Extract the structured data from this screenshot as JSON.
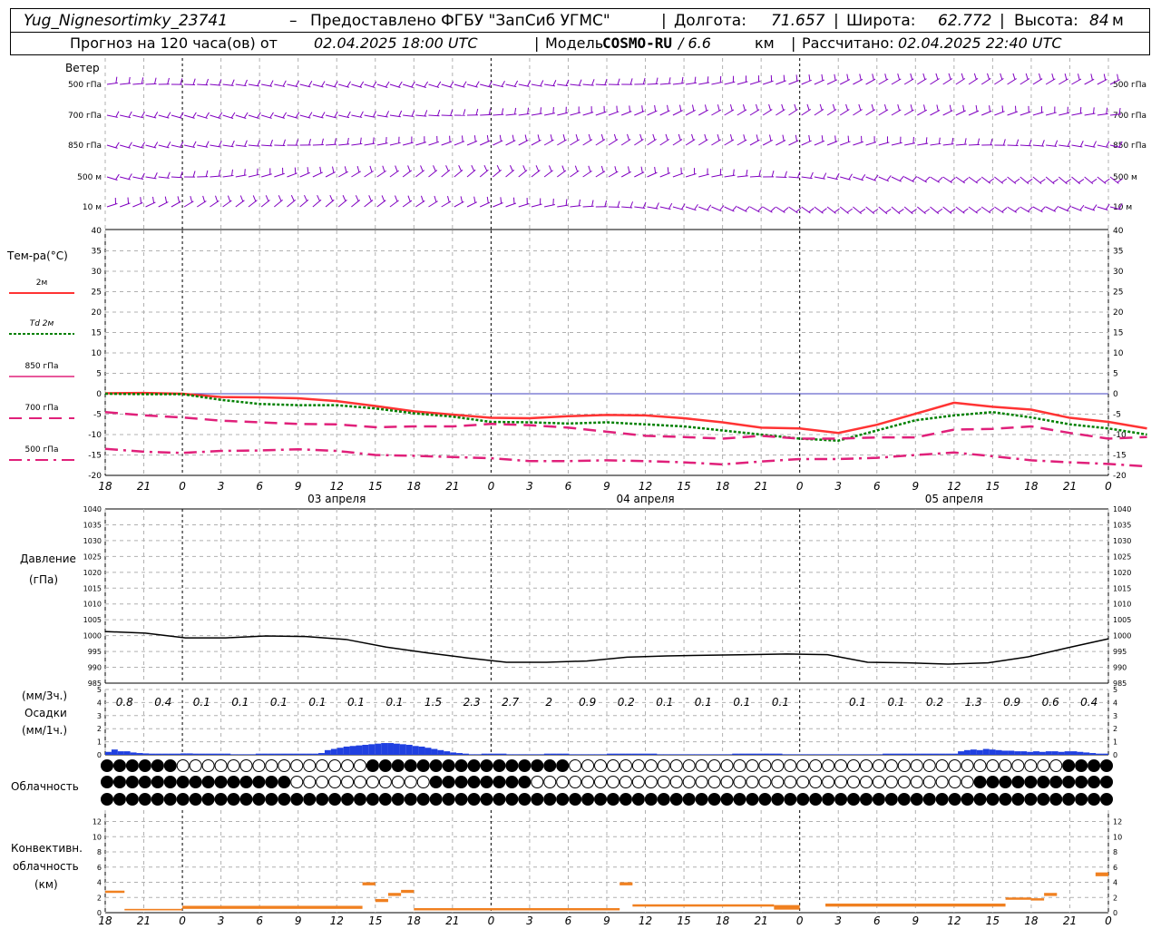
{
  "header": {
    "station": "Yug_Nignesortimky_23741",
    "dash": "–",
    "provided": "Предоставлено ФГБУ \"ЗапСиб УГМС\"",
    "lon_label": "Долгота:",
    "lon": "71.657",
    "lat_label": "Широта:",
    "lat": "62.772",
    "alt_label": "Высота:",
    "alt": "84",
    "alt_unit": "м",
    "forecast_label": "Прогноз на 120 часа(ов) от",
    "forecast_from": "02.04.2025 18:00 UTC",
    "model_label": "Модель",
    "model": "COSMO-RU",
    "resolution": "/ 6.6",
    "resolution_unit": "км",
    "calc_label": "Рассчитано:",
    "calc": "02.04.2025 22:40 UTC"
  },
  "wind_panel": {
    "title": "Ветер",
    "levels": [
      "500 гПа",
      "700 гПа",
      "850 гПа",
      "500 м",
      "10 м"
    ],
    "color": "#8000c0"
  },
  "temp_panel": {
    "title": "Тем-ра(°С)",
    "legend": [
      {
        "label": "2м",
        "color": "#ff3333",
        "style": "solid"
      },
      {
        "label": "Td  2м",
        "color": "#008000",
        "style": "dotted"
      },
      {
        "label": "850 гПа",
        "color": "#e0207a",
        "style": "solid-thin"
      },
      {
        "label": "700 гПа",
        "color": "#e0207a",
        "style": "dash"
      },
      {
        "label": "500 гПа",
        "color": "#e0207a",
        "style": "dashdot"
      }
    ]
  },
  "pressure_panel": {
    "title1": "Давление",
    "title2": "(гПа)"
  },
  "precip_panel": {
    "title1": "(мм/3ч.)",
    "title2": "Осадки",
    "title3": "(мм/1ч.)",
    "labels": [
      "0.8",
      "0.4",
      "0.1",
      "0.1",
      "0.1",
      "0.1",
      "0.1",
      "0.1",
      "1.5",
      "2.3",
      "2.7",
      "2",
      "0.9",
      "0.2",
      "0.1",
      "0.1",
      "0.1",
      "0.1",
      "",
      "0.1",
      "0.1",
      "0.2",
      "1.3",
      "0.9",
      "0.6",
      "0.4"
    ]
  },
  "cloud_panel": {
    "title": "Облачность"
  },
  "conv_panel": {
    "title1": "Конвективн.",
    "title2": "облачность",
    "title3": "(км)"
  },
  "date_labels": [
    "03 апреля",
    "04 апреля",
    "05 апреля"
  ],
  "hour_labels": [
    "18",
    "21",
    "0",
    "3",
    "6",
    "9",
    "12",
    "15",
    "18",
    "21",
    "0",
    "3",
    "6",
    "9",
    "12",
    "15",
    "18",
    "21",
    "0",
    "3",
    "6",
    "9",
    "12",
    "15",
    "18",
    "21",
    "0"
  ],
  "chart_data": [
    {
      "type": "line",
      "title": "Тем-ра(°С)",
      "x": [
        0,
        3,
        6,
        9,
        12,
        15,
        18,
        21,
        24,
        27,
        30,
        33,
        36,
        39,
        42,
        45,
        48,
        51,
        54,
        57,
        60,
        63,
        66,
        69,
        72,
        75,
        78
      ],
      "ylim": [
        -20,
        40
      ],
      "yticks": [
        -20,
        -15,
        -10,
        -5,
        0,
        5,
        10,
        15,
        20,
        25,
        30,
        35,
        40
      ],
      "series": [
        {
          "name": "2м",
          "values": [
            0.1,
            0.2,
            0.0,
            -0.8,
            -0.9,
            -1.1,
            -1.8,
            -3.0,
            -4.3,
            -5.1,
            -5.9,
            -6.0,
            -5.5,
            -5.2,
            -5.3,
            -6.0,
            -7.0,
            -8.3,
            -8.5,
            -9.6,
            -7.6,
            -4.9,
            -2.2,
            -3.2,
            -3.9,
            -5.9,
            -6.9,
            -8.5
          ]
        },
        {
          "name": "Td 2м",
          "values": [
            0.0,
            -0.1,
            -0.1,
            -1.5,
            -2.5,
            -2.8,
            -2.8,
            -3.6,
            -4.8,
            -5.6,
            -6.9,
            -7.0,
            -7.3,
            -7.0,
            -7.5,
            -8.0,
            -9.0,
            -10.0,
            -11.0,
            -11.5,
            -9.0,
            -6.5,
            -5.3,
            -4.5,
            -5.8,
            -7.5,
            -8.5,
            -10.0
          ]
        },
        {
          "name": "850 гПа",
          "values": []
        },
        {
          "name": "700 гПа",
          "values": [
            -4.5,
            -5.3,
            -5.8,
            -6.6,
            -7.0,
            -7.4,
            -7.5,
            -8.2,
            -8.0,
            -8.0,
            -7.4,
            -7.7,
            -8.3,
            -9.3,
            -10.3,
            -10.6,
            -11.0,
            -10.3,
            -11.0,
            -11.0,
            -10.7,
            -10.7,
            -8.8,
            -8.6,
            -8.0,
            -9.6,
            -11.0,
            -10.6
          ]
        },
        {
          "name": "500 гПа",
          "values": [
            -13.5,
            -14.2,
            -14.5,
            -14.0,
            -13.9,
            -13.6,
            -14.0,
            -15.0,
            -15.2,
            -15.5,
            -15.8,
            -16.5,
            -16.5,
            -16.3,
            -16.5,
            -16.8,
            -17.3,
            -16.6,
            -16.0,
            -16.0,
            -15.7,
            -15.0,
            -14.4,
            -15.3,
            -16.3,
            -16.8,
            -17.2,
            -17.8
          ]
        }
      ],
      "colors": [
        "#ff3333",
        "#008000",
        "#e0207a",
        "#e0207a",
        "#e0207a"
      ]
    },
    {
      "type": "line",
      "title": "Давление (гПа)",
      "x": [
        0,
        3,
        6,
        9,
        12,
        15,
        18,
        21,
        24,
        27,
        30,
        33,
        36,
        39,
        42,
        45,
        48,
        51,
        54,
        57,
        60,
        63,
        66,
        69,
        72,
        75,
        78
      ],
      "ylim": [
        985,
        1040
      ],
      "yticks": [
        985,
        990,
        995,
        1000,
        1005,
        1010,
        1015,
        1020,
        1025,
        1030,
        1035,
        1040
      ],
      "series": [
        {
          "name": "",
          "values": [
            1001.3,
            1000.8,
            999.3,
            999.3,
            999.9,
            999.7,
            998.8,
            996.4,
            994.6,
            993.0,
            991.6,
            991.6,
            992.0,
            993.2,
            993.6,
            993.8,
            994.0,
            994.2,
            994.0,
            991.6,
            991.4,
            991.0,
            991.4,
            993.3,
            996.2,
            999.0
          ]
        }
      ]
    },
    {
      "type": "bar",
      "title": "Осадки (мм/1ч.)",
      "ylim": [
        0,
        5
      ],
      "x_hours": "every 1h from 18 UTC",
      "series": [
        {
          "name": "",
          "values": [
            0.25,
            0.45,
            0.3,
            0.3,
            0.2,
            0.15,
            0.12,
            0.1,
            0.1,
            0.1,
            0.1,
            0.1,
            0.12,
            0.12,
            0.1,
            0.1,
            0.1,
            0.1,
            0.1,
            0.1,
            0.05,
            0.05,
            0.05,
            0.05,
            0.1,
            0.1,
            0.1,
            0.1,
            0.1,
            0.1,
            0.1,
            0.1,
            0.1,
            0.1,
            0.15,
            0.4,
            0.5,
            0.6,
            0.7,
            0.75,
            0.8,
            0.85,
            0.9,
            0.95,
            1.0,
            1.0,
            0.95,
            0.9,
            0.85,
            0.75,
            0.7,
            0.6,
            0.5,
            0.4,
            0.3,
            0.2,
            0.15,
            0.1,
            0.05,
            0.05,
            0.1,
            0.1,
            0.1,
            0.1,
            0.05,
            0.05,
            0.05,
            0.05,
            0.05,
            0.05,
            0.1,
            0.1,
            0.1,
            0.1,
            0.05,
            0.05,
            0.05,
            0.05,
            0.05,
            0.05,
            0.1,
            0.1,
            0.1,
            0.1,
            0.1,
            0.1,
            0.1,
            0.1,
            0.05,
            0.05,
            0.05,
            0.05,
            0.05,
            0.05,
            0.05,
            0.05,
            0.05,
            0.05,
            0.05,
            0.05,
            0.1,
            0.1,
            0.1,
            0.1,
            0.1,
            0.1,
            0.1,
            0.1,
            0.05,
            0.05,
            0.05,
            0.05,
            0.05,
            0.05,
            0.05,
            0.05,
            0.05,
            0.05,
            0.05,
            0.05,
            0.05,
            0.05,
            0.05,
            0.05,
            0.1,
            0.1,
            0.1,
            0.1,
            0.1,
            0.1,
            0.1,
            0.1,
            0.1,
            0.1,
            0.1,
            0.1,
            0.3,
            0.4,
            0.45,
            0.4,
            0.5,
            0.45,
            0.4,
            0.35,
            0.35,
            0.3,
            0.3,
            0.25,
            0.3,
            0.25,
            0.3,
            0.3,
            0.25,
            0.3,
            0.3,
            0.25,
            0.2,
            0.15,
            0.1,
            0.1
          ]
        }
      ]
    },
    {
      "type": "bar",
      "title": "Конвективн. облачность (км)",
      "ylim": [
        0,
        13
      ],
      "yticks": [
        0,
        2,
        4,
        6,
        8,
        10,
        12
      ]
    }
  ],
  "colors": {
    "wind": "#8000c0",
    "precip": "#2040e0",
    "conv": "#f08020",
    "grid": "#b0b0b0",
    "zero_line": "#4040c0"
  }
}
